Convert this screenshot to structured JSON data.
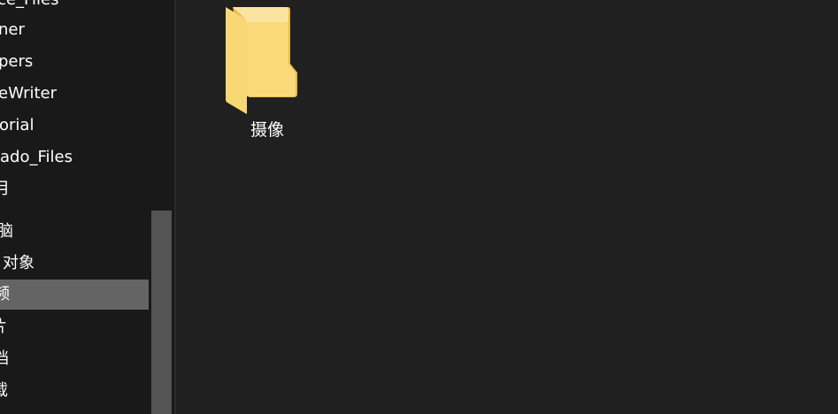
{
  "nav": {
    "items": [
      {
        "label": "ice_Files"
      },
      {
        "label": "ner"
      },
      {
        "label": "pers"
      },
      {
        "label": "eWriter"
      },
      {
        "label": "orial"
      },
      {
        "label": "ado_Files"
      },
      {
        "label": "月"
      },
      {
        "label": "脑"
      },
      {
        "label": "对象"
      },
      {
        "label": "频"
      },
      {
        "label": "片"
      },
      {
        "label": "档"
      },
      {
        "label": "载"
      }
    ],
    "selected_index": 9
  },
  "content": {
    "folders": [
      {
        "name": "摄像",
        "icon": "folder-icon"
      }
    ]
  },
  "colors": {
    "background": "#202020",
    "nav_background": "#191919",
    "selected_background": "#646464",
    "folder_yellow": "#F8D775",
    "text": "#FFFFFF"
  }
}
